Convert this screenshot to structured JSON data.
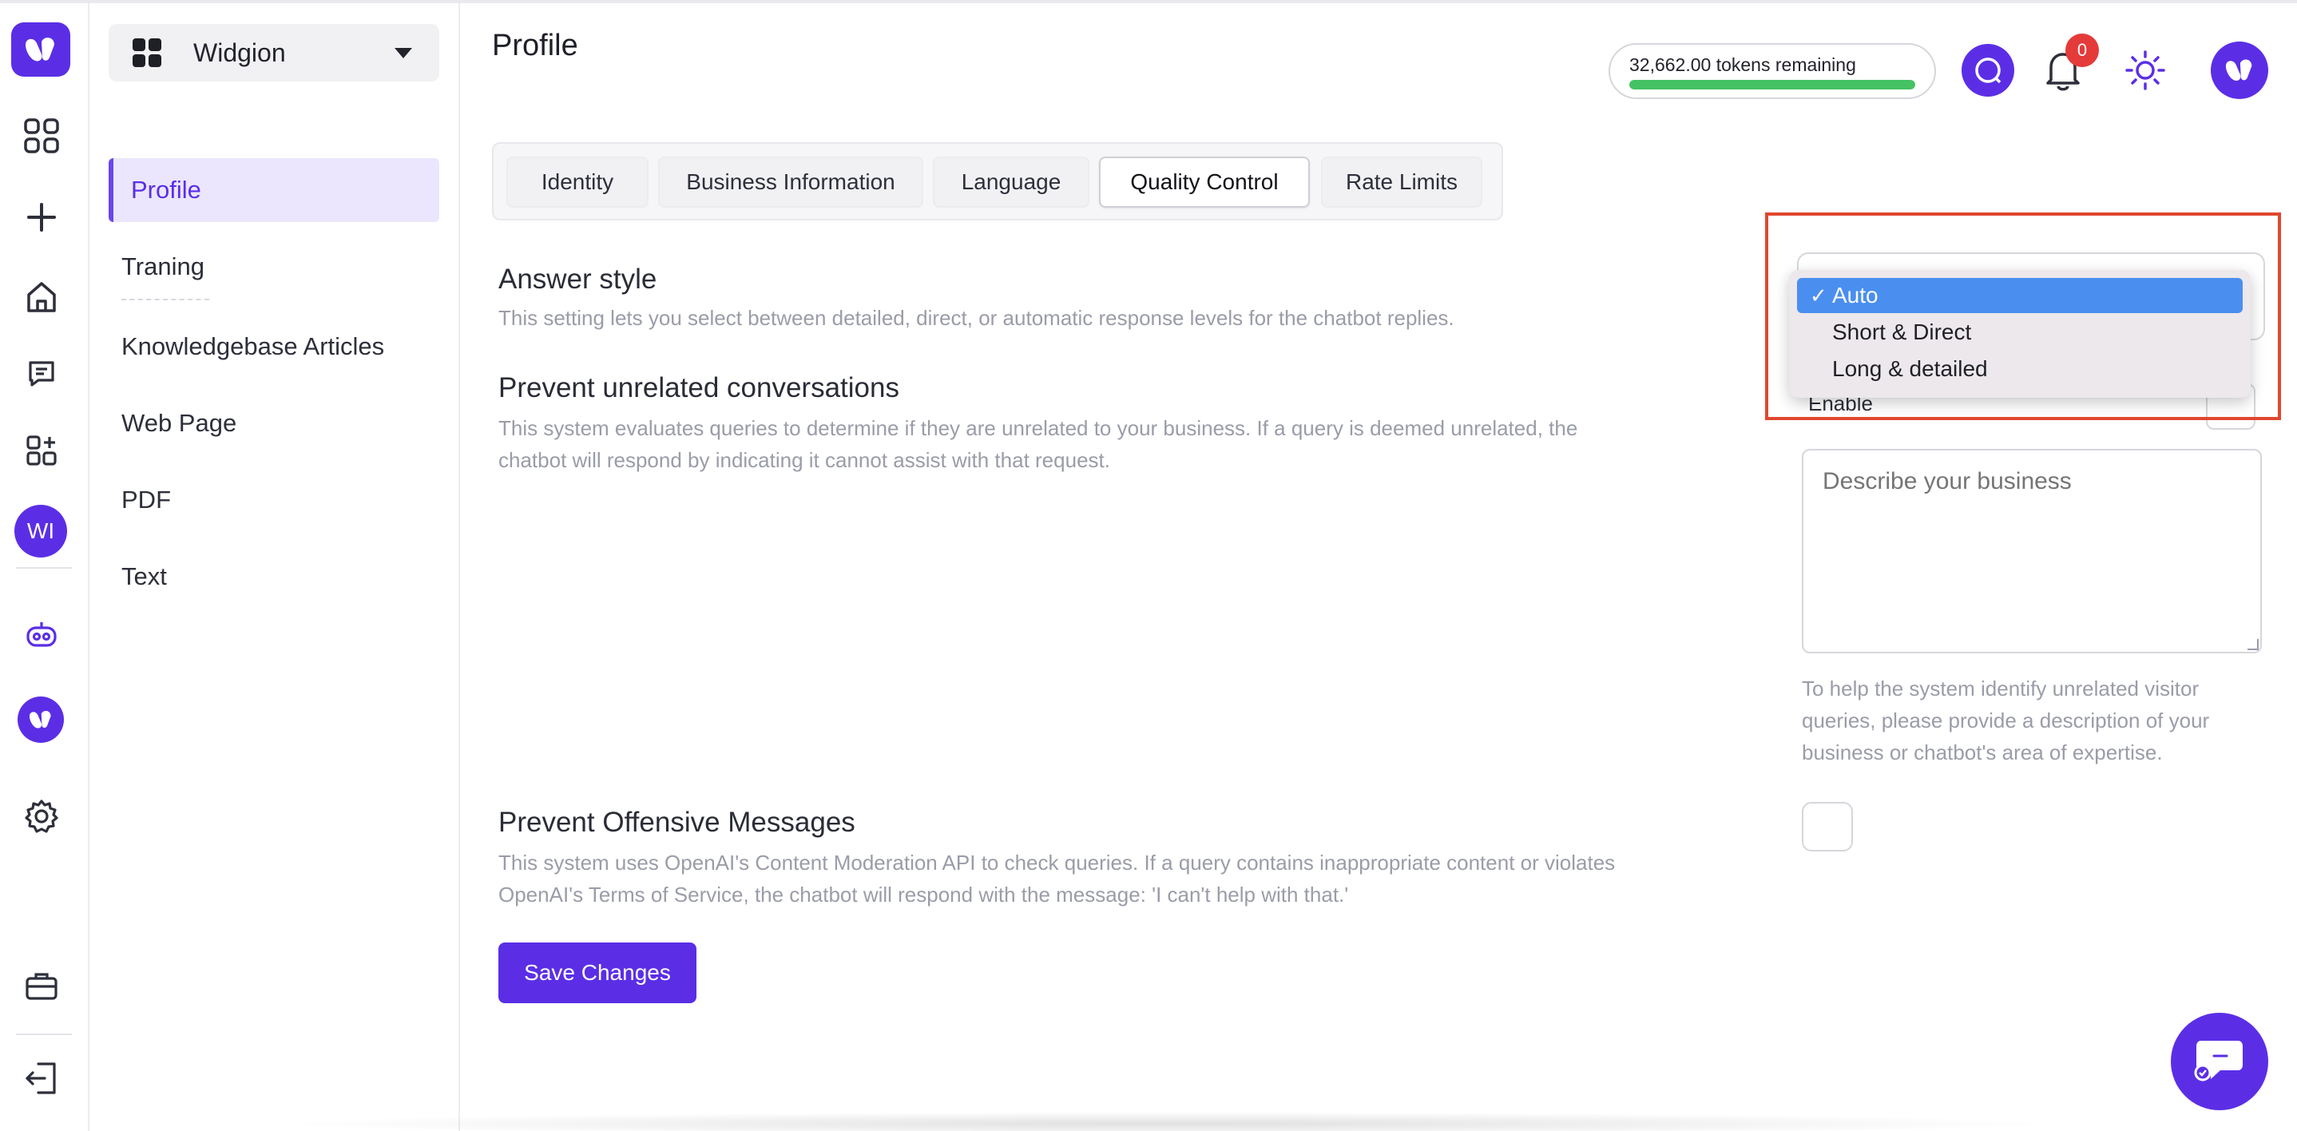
{
  "app": {
    "workspace_name": "Widgion",
    "rail_badge": "WI"
  },
  "sidebar": {
    "items": [
      {
        "label": "Profile",
        "active": true
      },
      {
        "label": "Traning",
        "active": false
      },
      {
        "label": "Knowledgebase Articles",
        "active": false
      },
      {
        "label": "Web Page",
        "active": false
      },
      {
        "label": "PDF",
        "active": false
      },
      {
        "label": "Text",
        "active": false
      }
    ]
  },
  "header": {
    "title": "Profile",
    "tokens_text": "32,662.00 tokens remaining",
    "tokens_fill_fraction": 1.0,
    "notification_count": "0"
  },
  "tabs": [
    {
      "label": "Identity",
      "active": false
    },
    {
      "label": "Business Information",
      "active": false
    },
    {
      "label": "Language",
      "active": false
    },
    {
      "label": "Quality Control",
      "active": true
    },
    {
      "label": "Rate Limits",
      "active": false
    }
  ],
  "sections": {
    "answer_style": {
      "title": "Answer style",
      "description": "This setting lets you select between detailed, direct, or automatic response levels for the chatbot replies.",
      "options": [
        "Auto",
        "Short & Direct",
        "Long & detailed"
      ],
      "selected": "Auto",
      "check_mark": "✓"
    },
    "unrelated": {
      "title": "Prevent unrelated conversations",
      "description_line1": "This system evaluates queries to determine if they are unrelated to your business. If a query is deemed unrelated, the",
      "description_line2": "chatbot will respond by indicating it cannot assist with that request.",
      "enable_label": "Enable",
      "textarea_placeholder": "Describe your business",
      "help_text": "To help the system identify unrelated visitor queries, please provide a description of your business or chatbot's area of expertise."
    },
    "offensive": {
      "title": "Prevent Offensive Messages",
      "description_line1": "This system uses OpenAI's Content Moderation API to check queries. If a query contains inappropriate content or violates",
      "description_line2": "OpenAI's Terms of Service, the chatbot will respond with the message: 'I can't help with that.'"
    }
  },
  "actions": {
    "save_label": "Save Changes"
  },
  "colors": {
    "brand": "#5b2ee6",
    "token_bar": "#45c263",
    "dropdown_highlight": "#4a8ff0",
    "annotation": "#e0472f",
    "badge": "#e53a3a"
  }
}
